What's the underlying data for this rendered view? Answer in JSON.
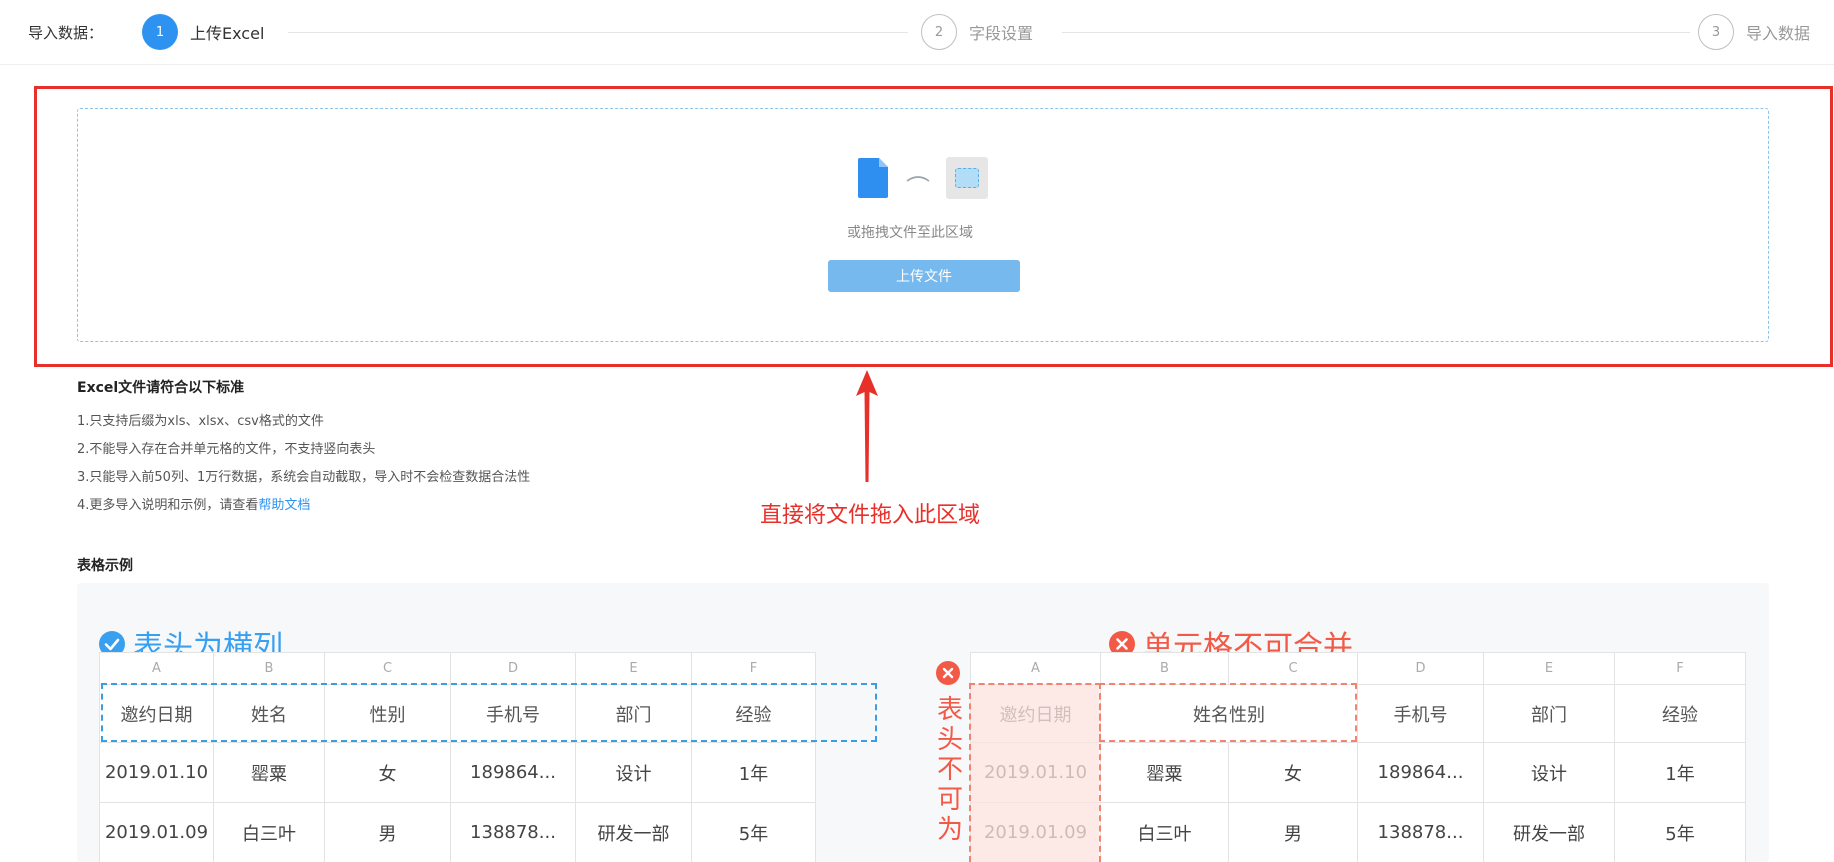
{
  "stepper": {
    "label": "导入数据：",
    "steps": [
      {
        "num": "1",
        "label": "上传Excel",
        "state": "active"
      },
      {
        "num": "2",
        "label": "字段设置",
        "state": "idle"
      },
      {
        "num": "3",
        "label": "导入数据",
        "state": "idle"
      }
    ]
  },
  "upload": {
    "drag_hint": "或拖拽文件至此区域",
    "button_label": "上传文件"
  },
  "standards": {
    "title": "Excel文件请符合以下标准",
    "rules": [
      "1.只支持后缀为xls、xlsx、csv格式的文件",
      "2.不能导入存在合并单元格的文件，不支持竖向表头",
      "3.只能导入前50列、1万行数据，系统会自动截取，导入时不会检查数据合法性"
    ],
    "rule4_prefix": "4.更多导入说明和示例，请查看",
    "help_link": "帮助文档"
  },
  "annotation": {
    "text": "直接将文件拖入此区域"
  },
  "example": {
    "title": "表格示例",
    "good": {
      "title": "表头为横列",
      "columns": [
        "A",
        "B",
        "C",
        "D",
        "E",
        "F"
      ],
      "header": [
        "邀约日期",
        "姓名",
        "性别",
        "手机号",
        "部门",
        "经验"
      ],
      "rows": [
        [
          "2019.01.10",
          "罂粟",
          "女",
          "189864...",
          "设计",
          "1年"
        ],
        [
          "2019.01.09",
          "白三叶",
          "男",
          "138878...",
          "研发一部",
          "5年"
        ]
      ]
    },
    "bad": {
      "title": "单元格不可合并",
      "side_text": "表头不可为",
      "columns": [
        "A",
        "B",
        "C",
        "D",
        "E",
        "F"
      ],
      "header": [
        "邀约日期",
        "姓名性别",
        "手机号",
        "部门",
        "经验"
      ],
      "rows": [
        [
          "2019.01.10",
          "罂粟",
          "女",
          "189864...",
          "设计",
          "1年"
        ],
        [
          "2019.01.09",
          "白三叶",
          "男",
          "138878...",
          "研发一部",
          "5年"
        ]
      ]
    }
  },
  "colors": {
    "primary": "#2e93f0",
    "annotation_red": "#e8302b",
    "good_blue": "#39a0f0",
    "bad_red": "#f25a47"
  }
}
